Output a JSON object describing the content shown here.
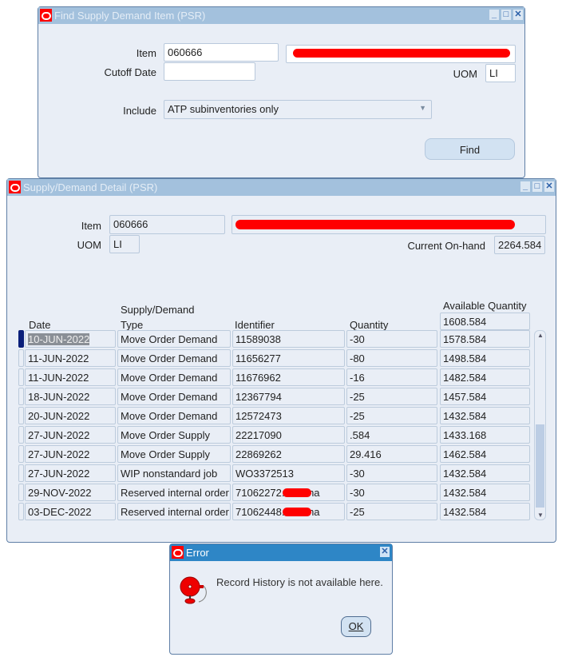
{
  "find_window": {
    "title": "Find Supply Demand Item (PSR)",
    "item_label": "Item",
    "item_value": "060666",
    "cutoff_label": "Cutoff Date",
    "cutoff_value": "",
    "uom_label": "UOM",
    "uom_value": "LI",
    "include_label": "Include",
    "include_value": "ATP subinventories only",
    "find_label": "Find"
  },
  "detail_window": {
    "title": "Supply/Demand Detail (PSR)",
    "item_label": "Item",
    "item_value": "060666",
    "uom_label": "UOM",
    "uom_value": "LI",
    "onhand_label": "Current On-hand",
    "onhand_value": "2264.584",
    "headers": {
      "date": "Date",
      "type_line1": "Supply/Demand",
      "type_line2": "Type",
      "identifier": "Identifier",
      "quantity": "Quantity",
      "available": "Available Quantity"
    },
    "opening_available": "1608.584",
    "rows": [
      {
        "date": "10-JUN-2022",
        "type": "Move Order Demand",
        "identifier": "11589038",
        "quantity": "-30",
        "available": "1578.584"
      },
      {
        "date": "11-JUN-2022",
        "type": "Move Order Demand",
        "identifier": "11656277",
        "quantity": "-80",
        "available": "1498.584"
      },
      {
        "date": "11-JUN-2022",
        "type": "Move Order Demand",
        "identifier": "11676962",
        "quantity": "-16",
        "available": "1482.584"
      },
      {
        "date": "18-JUN-2022",
        "type": "Move Order Demand",
        "identifier": "12367794",
        "quantity": "-25",
        "available": "1457.584"
      },
      {
        "date": "20-JUN-2022",
        "type": "Move Order Demand",
        "identifier": "12572473",
        "quantity": "-25",
        "available": "1432.584"
      },
      {
        "date": "27-JUN-2022",
        "type": "Move Order Supply",
        "identifier": "22217090",
        "quantity": ".584",
        "available": "1433.168"
      },
      {
        "date": "27-JUN-2022",
        "type": "Move Order Supply",
        "identifier": "22869262",
        "quantity": "29.416",
        "available": "1462.584"
      },
      {
        "date": "27-JUN-2022",
        "type": "WIP nonstandard job",
        "identifier": "WO3372513",
        "quantity": "-30",
        "available": "1432.584"
      },
      {
        "date": "29-NOV-2022",
        "type": "Reserved internal order",
        "identifier": "71062272.     Interna",
        "quantity": "-30",
        "available": "1432.584"
      },
      {
        "date": "03-DEC-2022",
        "type": "Reserved internal order",
        "identifier": "71062448.     Interna",
        "quantity": "-25",
        "available": "1432.584"
      }
    ]
  },
  "error_dialog": {
    "title": "Error",
    "message": "Record History is not available here.",
    "ok_label": "OK"
  },
  "icons": {
    "window_min": "minimize-icon",
    "window_max": "maximize-icon",
    "window_close": "close-icon",
    "alert": "bell-icon"
  },
  "colors": {
    "titlebar": "#a3c1dd",
    "error_titlebar": "#2e86c6",
    "window_bg": "#e9eef6",
    "redaction": "#ff0000"
  }
}
